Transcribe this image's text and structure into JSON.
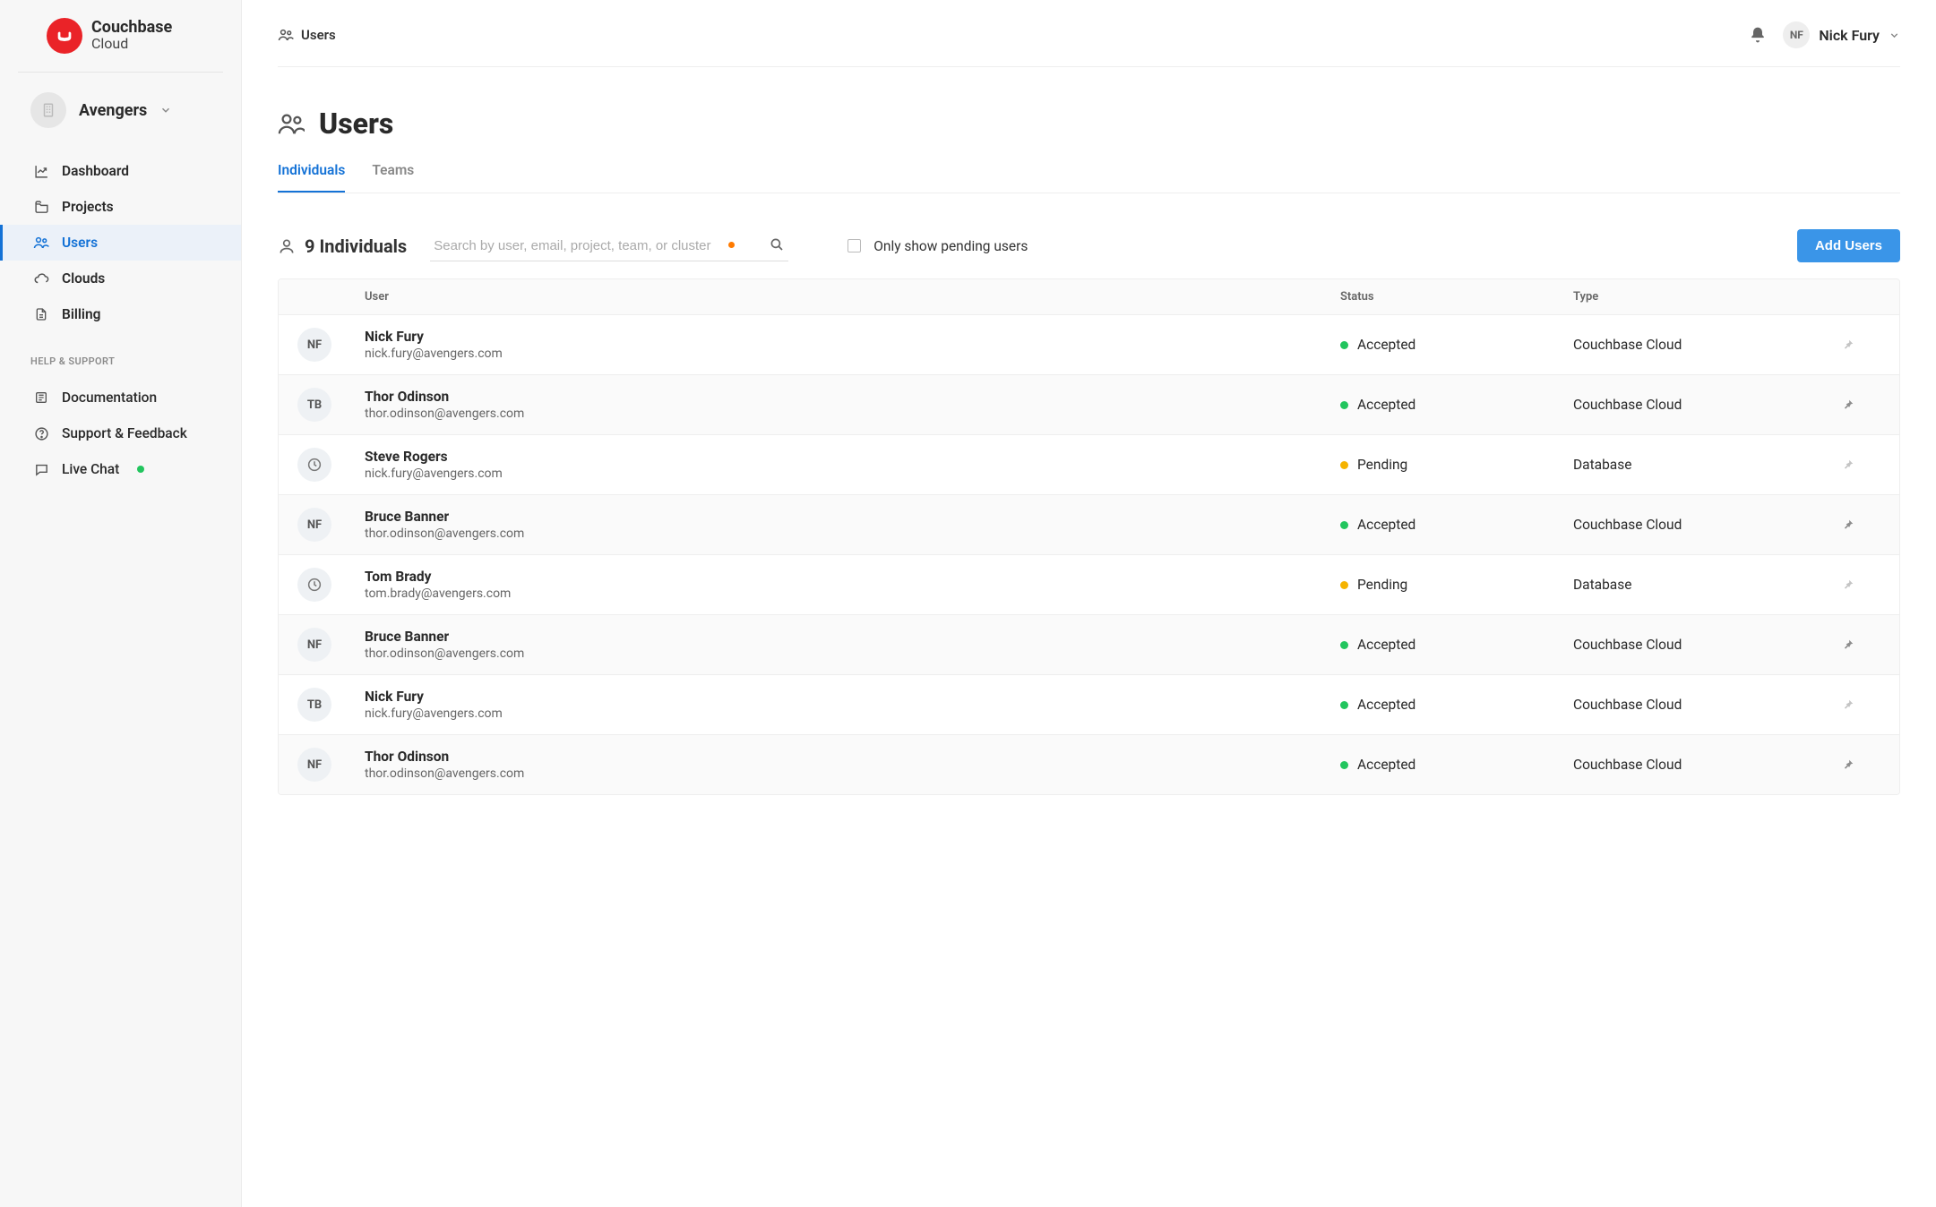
{
  "brand": {
    "line1": "Couchbase",
    "line2": "Cloud"
  },
  "org": {
    "name": "Avengers"
  },
  "sidebar": {
    "items": [
      {
        "label": "Dashboard",
        "icon": "chart-line-icon"
      },
      {
        "label": "Projects",
        "icon": "folder-icon"
      },
      {
        "label": "Users",
        "icon": "users-icon",
        "active": true
      },
      {
        "label": "Clouds",
        "icon": "cloud-icon"
      },
      {
        "label": "Billing",
        "icon": "file-icon"
      }
    ],
    "support_heading": "HELP & SUPPORT",
    "support_items": [
      {
        "label": "Documentation",
        "icon": "book-icon"
      },
      {
        "label": "Support & Feedback",
        "icon": "help-icon"
      },
      {
        "label": "Live Chat",
        "icon": "chat-icon",
        "dot": true
      }
    ]
  },
  "breadcrumb": {
    "label": "Users"
  },
  "current_user": {
    "initials": "NF",
    "name": "Nick Fury"
  },
  "page": {
    "title": "Users"
  },
  "tabs": [
    {
      "label": "Individuals",
      "active": true
    },
    {
      "label": "Teams"
    }
  ],
  "toolbar": {
    "count_text": "9 Individuals",
    "search_placeholder": "Search by user, email, project, team, or cluster",
    "filter_label": "Only show pending users",
    "add_button": "Add Users"
  },
  "table": {
    "headers": {
      "user": "User",
      "status": "Status",
      "type": "Type"
    },
    "rows": [
      {
        "avatar": "NF",
        "name": "Nick Fury",
        "email": "nick.fury@avengers.com",
        "status": "Accepted",
        "status_color": "green",
        "type": "Couchbase Cloud",
        "pin": "light"
      },
      {
        "avatar": "TB",
        "name": "Thor Odinson",
        "email": "thor.odinson@avengers.com",
        "status": "Accepted",
        "status_color": "green",
        "type": "Couchbase Cloud",
        "pin": "dark"
      },
      {
        "avatar": "clock",
        "name": "Steve Rogers",
        "email": "nick.fury@avengers.com",
        "status": "Pending",
        "status_color": "amber",
        "type": "Database",
        "pin": "light"
      },
      {
        "avatar": "NF",
        "name": "Bruce Banner",
        "email": "thor.odinson@avengers.com",
        "status": "Accepted",
        "status_color": "green",
        "type": "Couchbase Cloud",
        "pin": "dark"
      },
      {
        "avatar": "clock",
        "name": "Tom Brady",
        "email": "tom.brady@avengers.com",
        "status": "Pending",
        "status_color": "amber",
        "type": "Database",
        "pin": "light"
      },
      {
        "avatar": "NF",
        "name": "Bruce Banner",
        "email": "thor.odinson@avengers.com",
        "status": "Accepted",
        "status_color": "green",
        "type": "Couchbase Cloud",
        "pin": "dark"
      },
      {
        "avatar": "TB",
        "name": "Nick Fury",
        "email": "nick.fury@avengers.com",
        "status": "Accepted",
        "status_color": "green",
        "type": "Couchbase Cloud",
        "pin": "light"
      },
      {
        "avatar": "NF",
        "name": "Thor Odinson",
        "email": "thor.odinson@avengers.com",
        "status": "Accepted",
        "status_color": "green",
        "type": "Couchbase Cloud",
        "pin": "dark"
      }
    ]
  }
}
